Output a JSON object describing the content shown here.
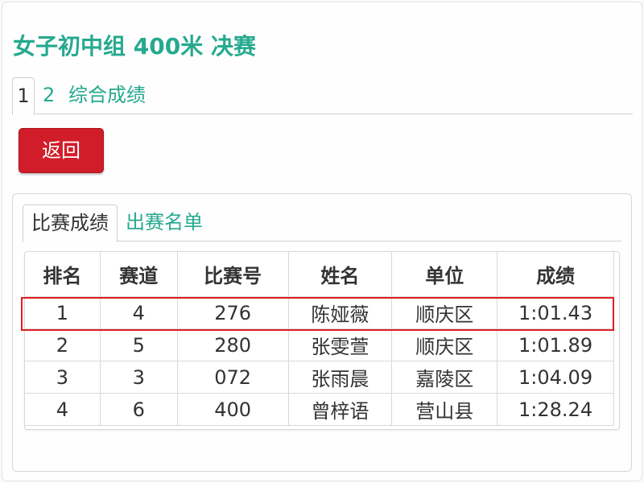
{
  "page": {
    "title": "女子初中组 400米 决赛"
  },
  "top_tabs": [
    {
      "label": "1"
    },
    {
      "label": "2"
    },
    {
      "label": "综合成绩"
    }
  ],
  "back_button": {
    "label": "返回"
  },
  "inner_tabs": [
    {
      "label": "比赛成绩"
    },
    {
      "label": "出赛名单"
    }
  ],
  "results_table": {
    "headers": [
      "排名",
      "赛道",
      "比赛号",
      "姓名",
      "单位",
      "成绩"
    ],
    "rows": [
      [
        "1",
        "4",
        "276",
        "陈娅薇",
        "顺庆区",
        "1:01.43"
      ],
      [
        "2",
        "5",
        "280",
        "张雯萱",
        "顺庆区",
        "1:01.89"
      ],
      [
        "3",
        "3",
        "072",
        "张雨晨",
        "嘉陵区",
        "1:04.09"
      ],
      [
        "4",
        "6",
        "400",
        "曾梓语",
        "营山县",
        "1:28.24"
      ]
    ]
  },
  "colors": {
    "accent": "#26a98f",
    "button": "#d11d29",
    "highlight": "#e01e24"
  }
}
